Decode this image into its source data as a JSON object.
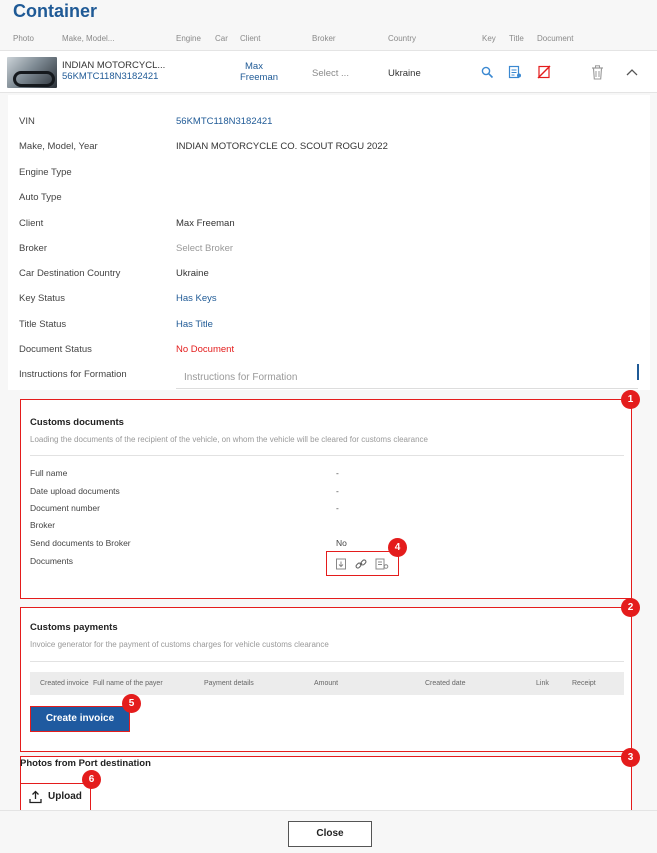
{
  "title": "Container",
  "columns": [
    "Photo",
    "Make, Model...",
    "Engine",
    "Car",
    "Client",
    "Broker",
    "Country",
    "Key",
    "Title",
    "Document"
  ],
  "vehicle_row": {
    "make": "INDIAN MOTORCYCL...",
    "vin": "56KMTC118N3182421",
    "client_first": "Max",
    "client_last": "Freeman",
    "broker_placeholder": "Select ...",
    "country": "Ukraine"
  },
  "details": [
    {
      "label": "VIN",
      "value": "56KMTC118N3182421",
      "style": "blue"
    },
    {
      "label": "Make, Model, Year",
      "value": "INDIAN MOTORCYCLE CO. SCOUT ROGU 2022",
      "style": "normal"
    },
    {
      "label": "Engine Type",
      "value": "",
      "style": "normal"
    },
    {
      "label": "Auto Type",
      "value": "",
      "style": "normal"
    },
    {
      "label": "Client",
      "value": "Max Freeman",
      "style": "normal"
    },
    {
      "label": "Broker",
      "value": "Select Broker",
      "style": "grey"
    },
    {
      "label": "Car Destination Country",
      "value": "Ukraine",
      "style": "normal"
    },
    {
      "label": "Key Status",
      "value": "Has Keys",
      "style": "blue"
    },
    {
      "label": "Title Status",
      "value": "Has Title",
      "style": "blue"
    },
    {
      "label": "Document Status",
      "value": "No Document",
      "style": "red"
    },
    {
      "label": "Instructions for Formation",
      "value": "",
      "style": "normal"
    }
  ],
  "instructions_placeholder": "Instructions for Formation",
  "customs_documents": {
    "title": "Customs documents",
    "subtitle": "Loading the documents of the recipient of the vehicle, on whom the vehicle will be cleared for customs clearance",
    "fields": [
      {
        "label": "Full name",
        "value": "-"
      },
      {
        "label": "Date upload documents",
        "value": "-"
      },
      {
        "label": "Document number",
        "value": "-"
      },
      {
        "label": "Broker",
        "value": ""
      },
      {
        "label": "Send documents to Broker",
        "value": "No"
      },
      {
        "label": "Documents",
        "value": ""
      }
    ]
  },
  "customs_payments": {
    "title": "Customs payments",
    "subtitle": "Invoice generator for the payment of customs charges for vehicle customs clearance",
    "headers": [
      "Created invoice",
      "Full name of the payer",
      "Payment details",
      "Amount",
      "Created date",
      "Link",
      "Receipt"
    ],
    "create_button": "Create invoice"
  },
  "port_photos": {
    "title": "Photos from Port destination",
    "upload_button": "Upload"
  },
  "badges": [
    "1",
    "2",
    "3",
    "4",
    "5",
    "6"
  ],
  "close_button": "Close",
  "colors": {
    "accent": "#1f5a96",
    "danger": "#e41c1c",
    "button": "#1f5aa0"
  }
}
